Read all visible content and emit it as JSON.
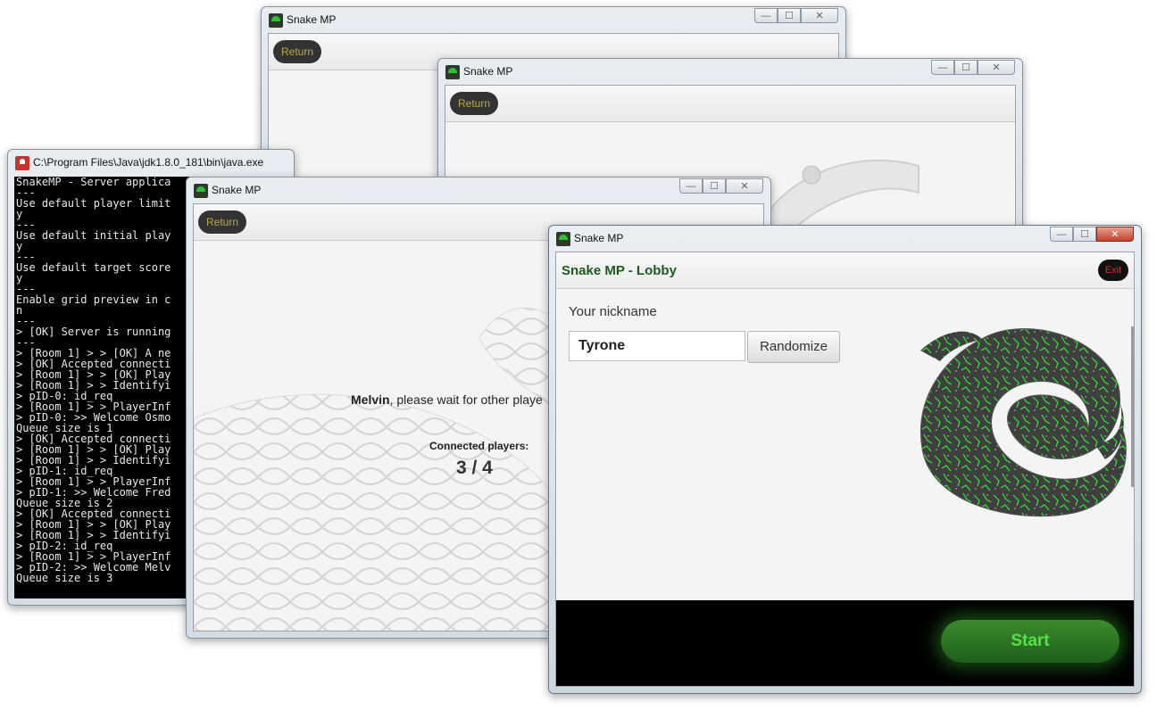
{
  "server_console": {
    "title": "C:\\Program Files\\Java\\jdk1.8.0_181\\bin\\java.exe",
    "lines": [
      "SnakeMP - Server applica",
      "---",
      "Use default player limit",
      "y",
      "---",
      "Use default initial play",
      "y",
      "---",
      "Use default target score",
      "y",
      "---",
      "Enable grid preview in c",
      "n",
      "---",
      "> [OK] Server is running",
      "---",
      "> [Room 1] > > [OK] A ne",
      "> [OK] Accepted connecti",
      "> [Room 1] > > [OK] Play",
      "> [Room 1] > > Identifyi",
      "> pID-0: id_req",
      "> [Room 1] > > PlayerInf",
      "> pID-0: >> Welcome Osmo",
      "Queue size is 1",
      "> [OK] Accepted connecti",
      "> [Room 1] > > [OK] Play",
      "> [Room 1] > > Identifyi",
      "> pID-1: id_req",
      "> [Room 1] > > PlayerInf",
      "> pID-1: >> Welcome Fred",
      "Queue size is 2",
      "> [OK] Accepted connecti",
      "> [Room 1] > > [OK] Play",
      "> [Room 1] > > Identifyi",
      "> pID-2: id_req",
      "> [Room 1] > > PlayerInf",
      "> pID-2: >> Welcome Melv",
      "Queue size is 3"
    ]
  },
  "window_back1": {
    "title": "Snake MP",
    "return_label": "Return"
  },
  "window_back2": {
    "title": "Snake MP",
    "return_label": "Return"
  },
  "window_waiting": {
    "title": "Snake MP",
    "return_label": "Return",
    "player_name": "Melvin",
    "wait_text": ", please wait for other playe",
    "connected_label": "Connected players:",
    "connected_count": "3 / 4"
  },
  "window_lobby": {
    "title": "Snake MP",
    "header_title": "Snake MP - Lobby",
    "exit_label": "Exit",
    "nickname_label": "Your nickname",
    "nickname_value": "Tyrone",
    "randomize_label": "Randomize",
    "start_label": "Start"
  },
  "window_controls": {
    "minimize": "—",
    "maximize": "☐",
    "close": "✕"
  },
  "colors": {
    "accent_green": "#3b8c2d",
    "return_text": "#b9a84b",
    "exit_text": "#cc3322"
  }
}
